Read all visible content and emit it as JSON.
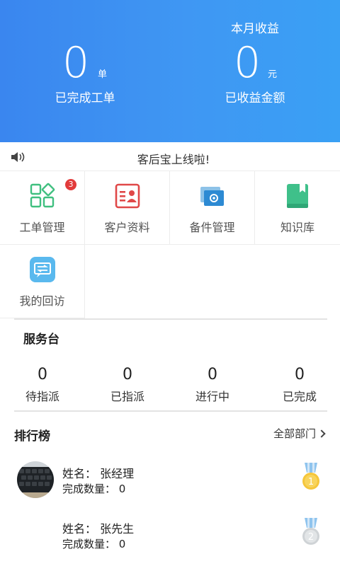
{
  "header": {
    "left": {
      "value": "0",
      "unit": "单",
      "label": "已完成工单"
    },
    "right": {
      "caption": "本月收益",
      "value": "0",
      "unit": "元",
      "label": "已收益金额"
    }
  },
  "notice": {
    "text": "客后宝上线啦!"
  },
  "grid": [
    {
      "label": "工单管理",
      "badge": "3",
      "icon": "grid-apps-icon"
    },
    {
      "label": "客户资料",
      "icon": "contact-card-icon"
    },
    {
      "label": "备件管理",
      "icon": "parts-photo-icon"
    },
    {
      "label": "知识库",
      "icon": "book-icon"
    },
    {
      "label": "我的回访",
      "icon": "chat-return-icon"
    }
  ],
  "service_desk": {
    "title": "服务台",
    "stats": [
      {
        "value": "0",
        "label": "待指派"
      },
      {
        "value": "0",
        "label": "已指派"
      },
      {
        "value": "0",
        "label": "进行中"
      },
      {
        "value": "0",
        "label": "已完成"
      }
    ]
  },
  "ranking": {
    "title": "排行榜",
    "filter": "全部部门",
    "entries": [
      {
        "name": "姓名：  张经理",
        "count": "完成数量：  0",
        "rank": "1"
      },
      {
        "name": "姓名：  张先生",
        "count": "完成数量：  0",
        "rank": "2"
      }
    ]
  },
  "colors": {
    "header_blue": "#3f97f3",
    "accent_green": "#3fbf7f",
    "accent_red": "#e04848",
    "badge_red": "#e23b3b"
  }
}
